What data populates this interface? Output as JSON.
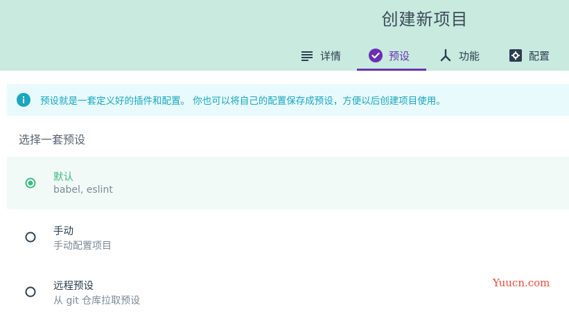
{
  "header": {
    "title": "创建新项目",
    "tabs": [
      {
        "label": "详情",
        "icon": "subject-icon",
        "active": false
      },
      {
        "label": "预设",
        "icon": "check-circle-icon",
        "active": true
      },
      {
        "label": "功能",
        "icon": "call-split-icon",
        "active": false
      },
      {
        "label": "配置",
        "icon": "settings-application-icon",
        "active": false
      }
    ]
  },
  "info": {
    "icon": "info-icon",
    "text": "预设就是一套定义好的插件和配置。 你也可以将自己的配置保存成预设，方便以后创建项目使用。"
  },
  "presets": {
    "title": "选择一套预设",
    "options": [
      {
        "label": "默认",
        "description": "babel, eslint",
        "selected": true
      },
      {
        "label": "手动",
        "description": "手动配置项目",
        "selected": false
      },
      {
        "label": "远程预设",
        "description": "从 git 仓库拉取预设",
        "selected": false
      }
    ]
  },
  "watermark": "Yuucn.com",
  "colors": {
    "header_bg": "#c8eadf",
    "accent": "#6b2fb3",
    "info_text": "#1aa6bd",
    "info_bg": "#e8fafb",
    "selected_green": "#42b983",
    "selected_bg": "#f1faf6",
    "watermark": "#e74c3c"
  }
}
